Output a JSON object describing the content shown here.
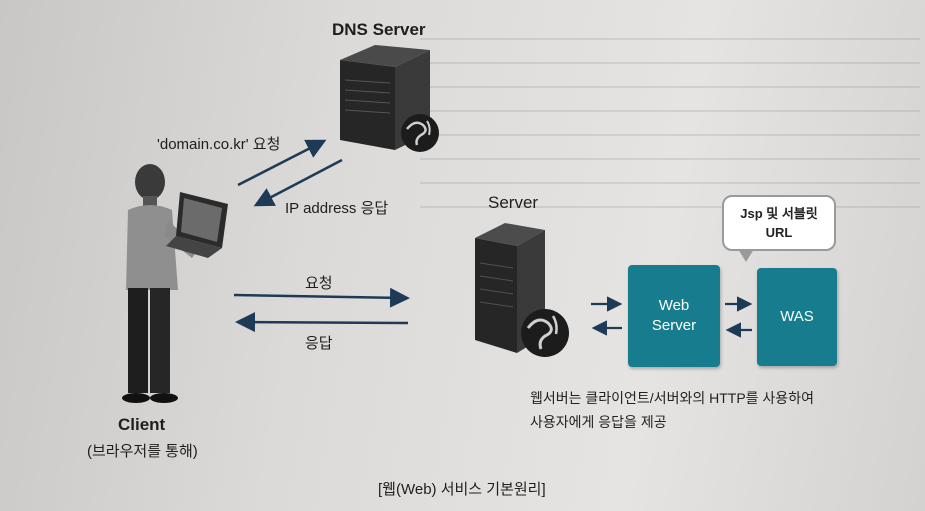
{
  "diagram": {
    "dns_server_label": "DNS Server",
    "server_label": "Server",
    "client_label": "Client",
    "client_sublabel": "(브라우저를 통해)",
    "domain_request_label": "'domain.co.kr' 요청",
    "ip_response_label": "IP address 응답",
    "request_label": "요청",
    "response_label": "응답",
    "web_server_label": "Web Server",
    "was_label": "WAS",
    "callout_label": "Jsp 및 서블릿 URL",
    "description_line1": "웹서버는 클라이언트/서버와의 HTTP를 사용하여",
    "description_line2": "사용자에게 응답을 제공",
    "figure_caption": "[웹(Web) 서비스 기본원리]"
  },
  "colors": {
    "teal_box": "#177d8e",
    "arrow": "#1f3a56",
    "server_body": "#2a2a2a"
  },
  "icons": [
    "dns-server-icon",
    "server-icon",
    "globe-icon",
    "person-with-laptop-icon",
    "arrow-icon"
  ]
}
